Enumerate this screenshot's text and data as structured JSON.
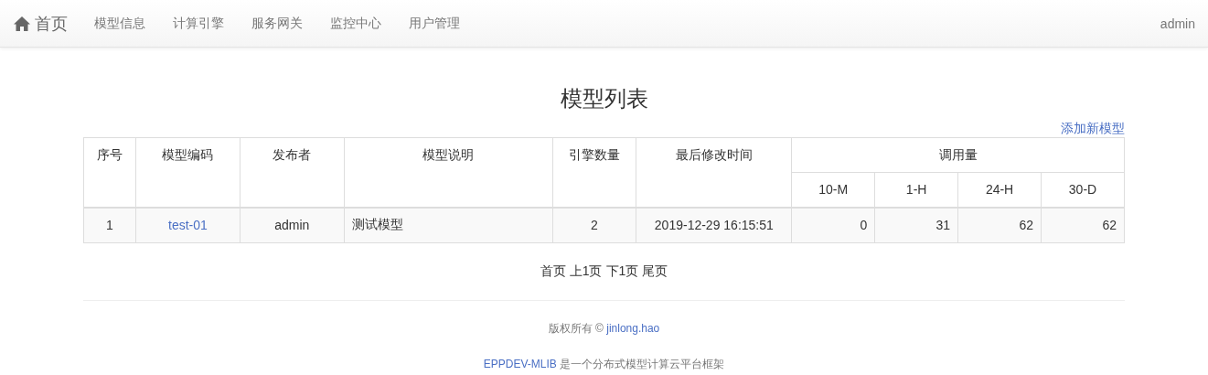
{
  "navbar": {
    "brand": "首页",
    "items": [
      "模型信息",
      "计算引擎",
      "服务网关",
      "监控中心",
      "用户管理"
    ],
    "user": "admin"
  },
  "page_title": "模型列表",
  "add_link": "添加新模型",
  "table": {
    "columns": [
      {
        "label": "序号"
      },
      {
        "label": "模型编码"
      },
      {
        "label": "发布者"
      },
      {
        "label": "模型说明"
      },
      {
        "label": "引擎数量"
      },
      {
        "label": "最后修改时间"
      }
    ],
    "group_column": {
      "label": "调用量",
      "subcolumns": [
        "10-M",
        "1-H",
        "24-H",
        "30-D"
      ]
    },
    "rows": [
      {
        "index": "1",
        "code": "test-01",
        "publisher": "admin",
        "description": "测试模型",
        "engines": "2",
        "modified": "2019-12-29 16:15:51",
        "calls": [
          "0",
          "31",
          "62",
          "62"
        ]
      }
    ]
  },
  "pagination": [
    "首页",
    "上1页",
    "下1页",
    "尾页"
  ],
  "footer": {
    "copyright": "版权所有 ©",
    "author": "jinlong.hao",
    "product": "EPPDEV-MLIB",
    "tagline": "是一个分布式模型计算云平台框架"
  }
}
